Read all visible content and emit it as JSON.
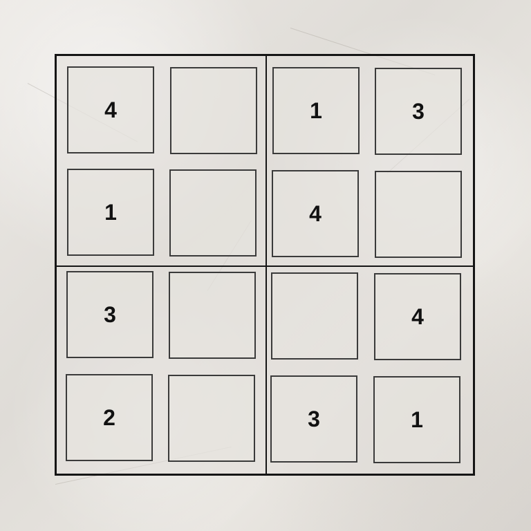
{
  "puzzle": {
    "size": 4,
    "cells": [
      [
        "4",
        "",
        "1",
        "3"
      ],
      [
        "1",
        "",
        "4",
        ""
      ],
      [
        "3",
        "",
        "",
        "4"
      ],
      [
        "2",
        "",
        "3",
        "1"
      ]
    ]
  },
  "colors": {
    "grid_line": "#151515",
    "cell_border": "#3a3a3a",
    "digit": "#111111",
    "paper": "#e5e2dd"
  }
}
